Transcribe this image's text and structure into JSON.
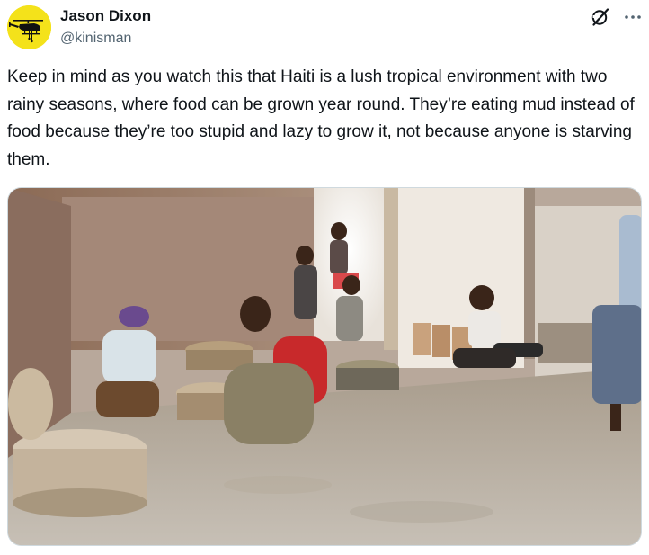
{
  "author": {
    "display_name": "Jason Dixon",
    "handle": "@kinisman",
    "avatar_icon": "helicopter-silhouette-icon",
    "avatar_bg": "#f4e21a"
  },
  "header_actions": {
    "grok_icon": "grok-slash-circle-icon",
    "more_icon": "more-dots-icon"
  },
  "tweet": {
    "text": "Keep in mind as you watch this that Haiti is a lush tropical environment with two rainy seasons, where food can be grown year round. They’re eating mud instead of food because they’re too stupid and lazy to grow it, not because anyone is starving them."
  },
  "media": {
    "type": "video-still"
  },
  "colors": {
    "text_primary": "#0f1419",
    "text_secondary": "#536471",
    "border": "#cfd9de"
  }
}
